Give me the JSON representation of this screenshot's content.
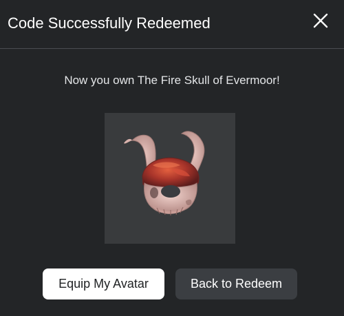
{
  "modal": {
    "title": "Code Successfully Redeemed",
    "message": "Now you own The Fire Skull of Evermoor!",
    "item_image_icon": "fire-skull-horned-helmet",
    "buttons": {
      "equip_label": "Equip My Avatar",
      "back_label": "Back to Redeem"
    },
    "colors": {
      "background": "#232527",
      "thumbnail_bg": "#393b3d",
      "primary_button": "#ffffff",
      "secondary_button": "#3b3e42"
    }
  }
}
